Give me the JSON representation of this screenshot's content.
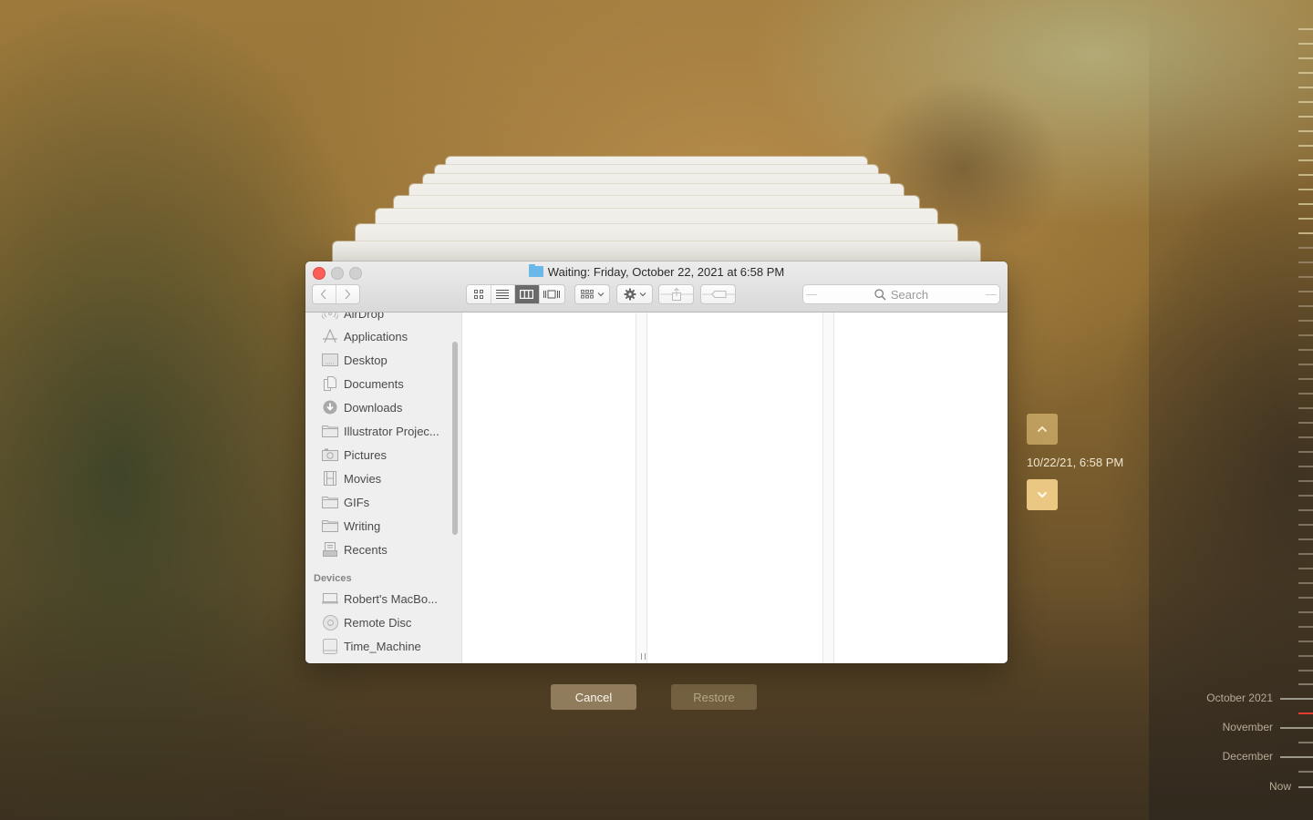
{
  "window": {
    "title": "Waiting: Friday, October 22, 2021 at 6:58 PM",
    "title_icon": "folder-icon",
    "search_placeholder": "Search",
    "view_modes": [
      {
        "name": "icon-view",
        "active": false
      },
      {
        "name": "list-view",
        "active": false
      },
      {
        "name": "column-view",
        "active": true
      },
      {
        "name": "cover-flow-view",
        "active": false
      }
    ],
    "toolbar": {
      "back": "back",
      "forward": "forward",
      "arrange": "arrange-menu",
      "action": "action-menu",
      "share": "share",
      "tags": "tags"
    }
  },
  "sidebar": {
    "favorites": [
      {
        "label": "AirDrop",
        "icon": "airdrop-icon"
      },
      {
        "label": "Applications",
        "icon": "applications-icon"
      },
      {
        "label": "Desktop",
        "icon": "desktop-icon"
      },
      {
        "label": "Documents",
        "icon": "documents-icon"
      },
      {
        "label": "Downloads",
        "icon": "downloads-icon"
      },
      {
        "label": "Illustrator Projec...",
        "icon": "folder-icon"
      },
      {
        "label": "Pictures",
        "icon": "camera-icon"
      },
      {
        "label": "Movies",
        "icon": "film-icon"
      },
      {
        "label": "GIFs",
        "icon": "folder-icon"
      },
      {
        "label": "Writing",
        "icon": "folder-icon"
      },
      {
        "label": "Recents",
        "icon": "recents-icon"
      }
    ],
    "devices_header": "Devices",
    "devices": [
      {
        "label": "Robert's MacBo...",
        "icon": "laptop-icon"
      },
      {
        "label": "Remote Disc",
        "icon": "disc-icon"
      },
      {
        "label": "Time_Machine",
        "icon": "drive-icon"
      }
    ]
  },
  "buttons": {
    "cancel": "Cancel",
    "restore": "Restore"
  },
  "navigator": {
    "current_snapshot": "10/22/21, 6:58 PM"
  },
  "timeline": {
    "labels": [
      "October 2021",
      "November",
      "December",
      "Now"
    ],
    "current_marker_color": "#e53a2f"
  },
  "colors": {
    "close_button": "#fc5f57",
    "active_segment": "#6a6a6a"
  }
}
